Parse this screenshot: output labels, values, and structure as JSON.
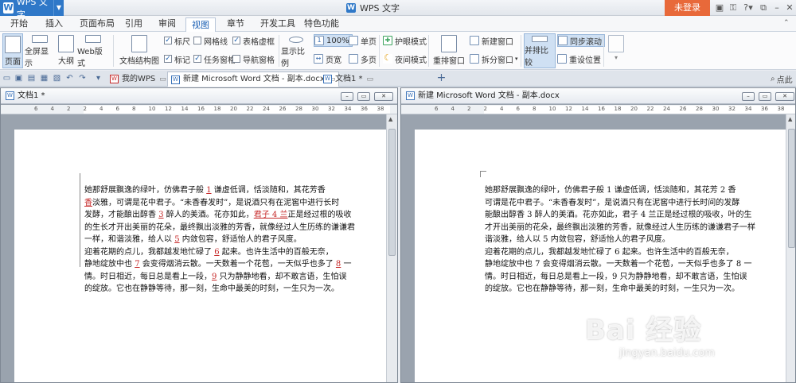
{
  "app": {
    "name": "WPS 文字",
    "window_title": "WPS 文字",
    "login_label": "未登录"
  },
  "menu": [
    "开始",
    "插入",
    "页面布局",
    "引用",
    "审阅",
    "视图",
    "章节",
    "开发工具",
    "特色功能"
  ],
  "ribbon": {
    "page_view": "页面",
    "fullscreen": "全屏显示",
    "outline": "大纲",
    "web_layout": "Web版式",
    "doc_structure": "文档结构图",
    "ruler": "标尺",
    "gridlines": "网格线",
    "table_borders": "表格虚框",
    "marks": "标记",
    "task_pane": "任务窗格",
    "nav_pane": "导航窗格",
    "zoom": "显示比例",
    "zoom_100": "100%",
    "single_page": "单页",
    "page_width": "页宽",
    "multi_page": "多页",
    "eye_mode": "护眼模式",
    "night_mode": "夜间模式",
    "arrange": "重排窗口",
    "new_window": "新建窗口",
    "split_window": "拆分窗口",
    "side_by_side": "并排比较",
    "sync_scroll": "同步滚动",
    "reset_position": "重设位置"
  },
  "tabs": {
    "my_wps": "我的WPS",
    "tab1": "新建 Microsoft Word 文档 - 副本.docx",
    "tab2": "文档1 *",
    "search": "点此"
  },
  "left_pane": {
    "title": "文档1 *"
  },
  "right_pane": {
    "title": "新建 Microsoft Word 文档 - 副本.docx"
  },
  "document": {
    "left": {
      "p1": [
        [
          "    她那舒展飘逸的绿叶，仿佛君子般 ",
          "1",
          " 谦虚低调，恬淡随和，其花芳香"
        ],
        [
          "",
          "香",
          "淡雅，可谓是花中君子。“未香春发时”，是说酒只有在泥窖中进行长时"
        ],
        [
          "发酵，才能酿出醇香 ",
          "3",
          " 醉人的美酒。花亦如此，",
          "君子 4 兰",
          "正是经过根的吸收"
        ],
        [
          "的生长才开出美丽的花朵，最终飘出淡雅的芳香，就像经过人生历练的谦谦君"
        ],
        [
          "一样，和谐淡雅，给人以 ",
          "5",
          " 内敛包容，舒适怡人的君子风度。"
        ]
      ],
      "p2": [
        [
          "    迎着花期的点儿，我都越发地忙碌了 ",
          "6",
          " 起来。也许生活中的百般无奈，"
        ],
        [
          "静地绽放中也 ",
          "7",
          " 会变得烟消云散。一天数着一个花苞，一天似乎也多了 ",
          "8",
          " 一"
        ],
        [
          "情。时日相近，每日总是看上一段，",
          "9",
          " 只为静静地看，却不敢言语，生怕误"
        ],
        [
          "的绽放。它也在静静等待，那一刻，生命中最美的时刻，一生只为一次。"
        ]
      ]
    },
    "right": {
      "p1": [
        "    她那舒展飘逸的绿叶，仿佛君子般 1 谦虚低调，恬淡随和，其花芳 2 香",
        "可谓是花中君子。“未香春发时”，是说酒只有在泥窖中进行长时间的发酵",
        "能酿出醇香 3 醉人的美酒。花亦如此，君子 4 兰正是经过根的吸收，叶的生",
        "才开出美丽的花朵，最终飘出淡雅的芳香，就像经过人生历练的谦谦君子一样",
        "谐淡雅，给人以 5 内敛包容，舒适怡人的君子风度。"
      ],
      "p2": [
        "    迎着花期的点儿，我都越发地忙碌了 6 起来。也许生活中的百般无奈，",
        "静地绽放中也 7 会变得烟消云散。一天数着一个花苞，一天似乎也多了 8 一",
        "情。时日相近，每日总是看上一段，9 只为静静地看，却不敢言语，生怕误",
        "的绽放。它也在静静等待，那一刻，生命中最美的时刻，一生只为一次。"
      ]
    }
  },
  "ruler_ticks": [
    "6",
    "4",
    "2",
    "2",
    "4",
    "6",
    "8",
    "10",
    "12",
    "14",
    "16",
    "18",
    "20",
    "22",
    "24",
    "26",
    "28",
    "30",
    "32",
    "34",
    "36",
    "38"
  ],
  "watermark": {
    "brand": "Bai 经验",
    "url": "jingyan.baidu.com"
  }
}
